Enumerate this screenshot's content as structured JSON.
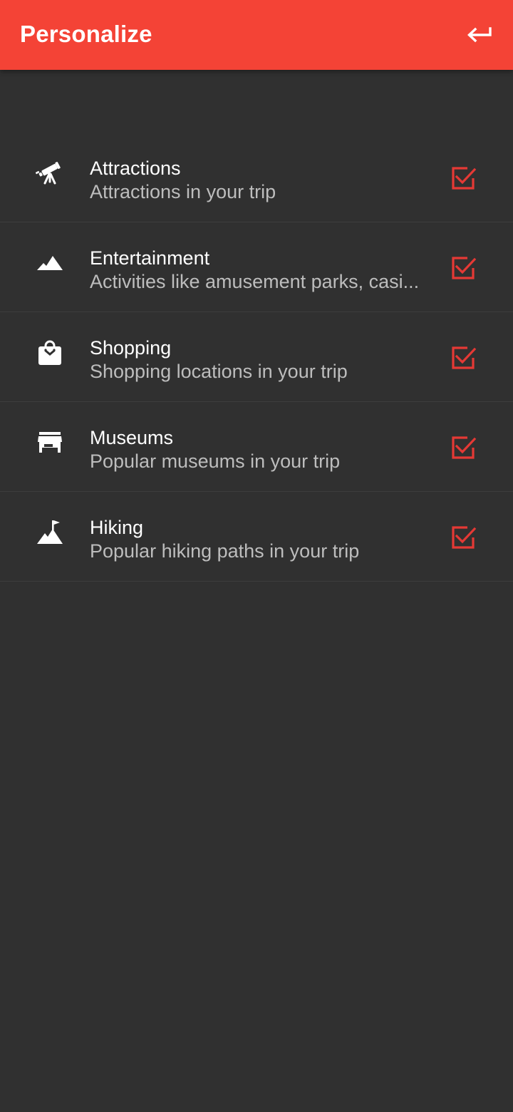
{
  "appbar": {
    "title": "Personalize",
    "back_icon": "keyboard-return-icon",
    "color": "#F44336"
  },
  "theme": {
    "background": "#303030",
    "checkbox_color": "#E53935"
  },
  "categories": [
    {
      "icon": "telescope-icon",
      "title": "Attractions",
      "subtitle": "Attractions in your trip",
      "checked": true
    },
    {
      "icon": "mountains-icon",
      "title": "Entertainment",
      "subtitle": "Activities like amusement parks, casi...",
      "checked": true
    },
    {
      "icon": "shopping-bag-icon",
      "title": "Shopping",
      "subtitle": "Shopping locations in your trip",
      "checked": true
    },
    {
      "icon": "storefront-icon",
      "title": "Museums",
      "subtitle": "Popular museums in your trip",
      "checked": true
    },
    {
      "icon": "summit-flag-icon",
      "title": "Hiking",
      "subtitle": "Popular hiking paths in your trip",
      "checked": true
    }
  ]
}
